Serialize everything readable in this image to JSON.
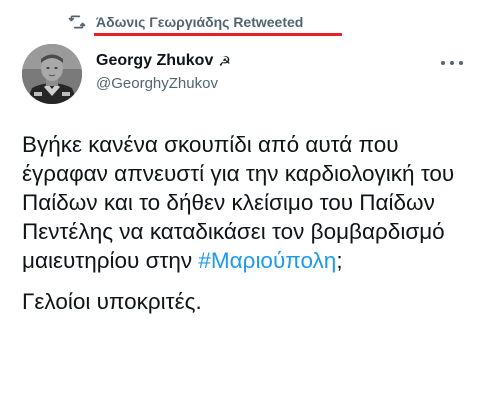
{
  "retweet": {
    "icon": "retweet-icon",
    "label": "Άδωνις Γεωργιάδης Retweeted",
    "highlight_color": "#e8202a"
  },
  "author": {
    "avatar_icon": "avatar-photo",
    "display_name": "Georgy Zhukov",
    "badge": "☭",
    "handle": "@GeorghyZhukov"
  },
  "menu": {
    "icon": "more-options-icon"
  },
  "tweet": {
    "paragraph1_text": "Βγήκε κανένα σκουπίδι από αυτά που έγραφαν απνευστί για την καρδιολογική του Παίδων και το δήθεν κλείσιμο του Παίδων Πεντέλης να καταδικάσει τον βομβαρδισμό μαιευτηρίου στην ",
    "hashtag": "#Μαριούπολη",
    "paragraph1_end": ";",
    "paragraph2": "Γελοίοι υποκριτές."
  },
  "colors": {
    "text_primary": "#0f1419",
    "text_secondary": "#536471",
    "link": "#1d9bf0"
  }
}
